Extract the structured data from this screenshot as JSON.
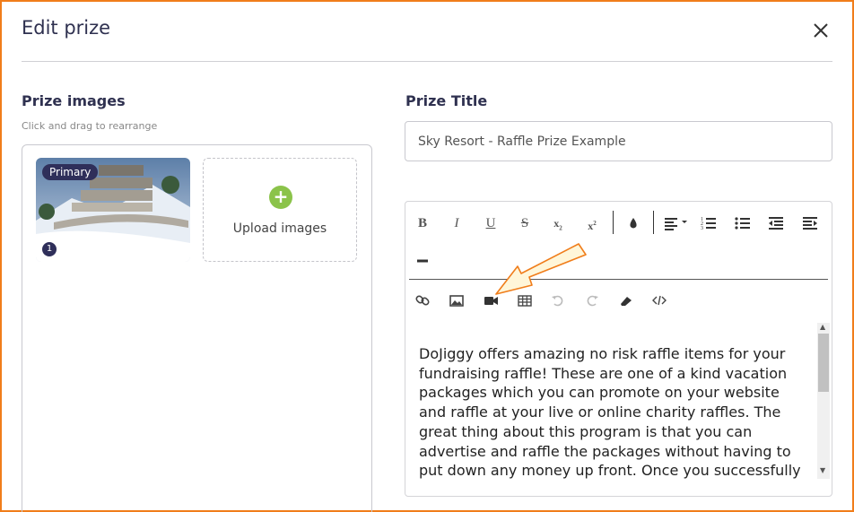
{
  "modal": {
    "title": "Edit prize",
    "close_label": "×"
  },
  "images": {
    "heading": "Prize images",
    "hint": "Click and drag to rearrange",
    "items": [
      {
        "badge": "Primary",
        "order": "1"
      }
    ],
    "upload_label": "Upload images"
  },
  "prize": {
    "heading": "Prize Title",
    "title_value": "Sky Resort - Raffle Prize Example",
    "description": "DoJiggy offers amazing no risk raffle items for your fundraising raffle! These are one of a kind vacation packages which you can promote on your website and raffle at your live or online charity raffles. The great thing about this program is that you can advertise and raffle the packages without having to put down any money up front. Once you successfully"
  },
  "toolbar": {
    "row1": [
      "bold-icon",
      "italic-icon",
      "underline-icon",
      "strikethrough-icon",
      "subscript-icon",
      "superscript-icon",
      "color-drop-icon",
      "align-icon",
      "ordered-list-icon",
      "unordered-list-icon",
      "outdent-icon",
      "indent-icon",
      "horizontal-rule-icon"
    ],
    "row2": [
      "link-icon",
      "image-icon",
      "video-icon",
      "table-icon",
      "undo-icon",
      "redo-icon",
      "eraser-icon",
      "code-icon"
    ]
  },
  "colors": {
    "accent_border": "#f07d1a",
    "badge": "#2f2f5a",
    "upload_plus": "#8bc34a",
    "title": "#2f3150"
  }
}
